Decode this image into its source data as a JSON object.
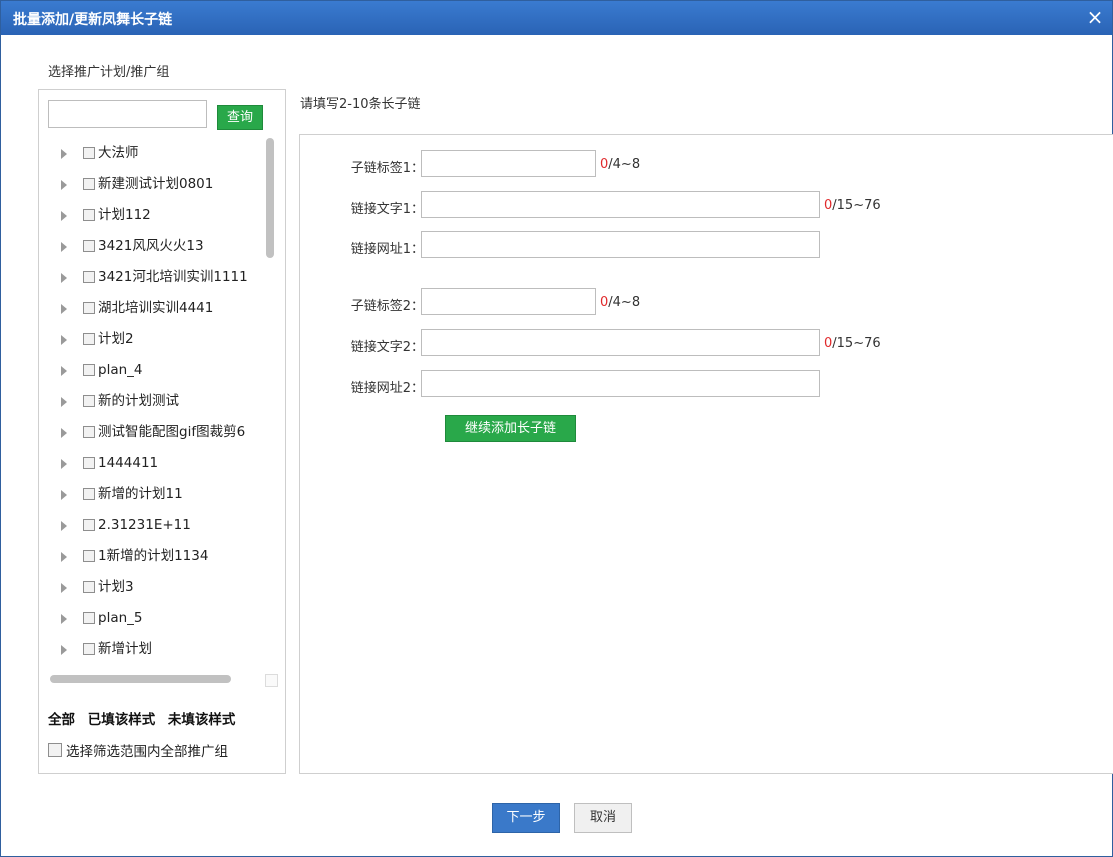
{
  "dialog": {
    "title": "批量添加/更新凤舞长子链",
    "close_label": "×"
  },
  "section_label": "选择推广计划/推广组",
  "search": {
    "value": "",
    "placeholder": "",
    "button_label": "查询"
  },
  "tree": {
    "items": [
      {
        "label": "大法师"
      },
      {
        "label": "新建测试计划0801"
      },
      {
        "label": "计划112"
      },
      {
        "label": "3421风风火火13"
      },
      {
        "label": "3421河北培训实训1111"
      },
      {
        "label": "湖北培训实训4441"
      },
      {
        "label": "计划2"
      },
      {
        "label": "plan_4"
      },
      {
        "label": "新的计划测试"
      },
      {
        "label": "测试智能配图gif图裁剪6"
      },
      {
        "label": "1444411"
      },
      {
        "label": "新增的计划11"
      },
      {
        "label": "2.31231E+11"
      },
      {
        "label": "1新增的计划1134"
      },
      {
        "label": "计划3"
      },
      {
        "label": "plan_5"
      },
      {
        "label": "新增计划"
      }
    ]
  },
  "filters": {
    "all": "全部",
    "filled": "已填该样式",
    "unfilled": "未填该样式"
  },
  "select_all_label": "选择筛选范围内全部推广组",
  "instruction": "请填写2-10条长子链",
  "links": [
    {
      "tag_label": "子链标签1：",
      "tag_value": "",
      "tag_count": "0",
      "tag_range": "/4~8",
      "text_label": "链接文字1：",
      "text_value": "",
      "text_count": "0",
      "text_range": "/15~76",
      "url_label": "链接网址1：",
      "url_value": ""
    },
    {
      "tag_label": "子链标签2：",
      "tag_value": "",
      "tag_count": "0",
      "tag_range": "/4~8",
      "text_label": "链接文字2：",
      "text_value": "",
      "text_count": "0",
      "text_range": "/15~76",
      "url_label": "链接网址2：",
      "url_value": ""
    }
  ],
  "add_button_label": "继续添加长子链",
  "footer": {
    "next_label": "下一步",
    "cancel_label": "取消"
  },
  "colors": {
    "title_bar": "#2d6cbf",
    "green_button": "#29a84a",
    "primary_button": "#3a79c9",
    "count_red": "#e0292b"
  }
}
